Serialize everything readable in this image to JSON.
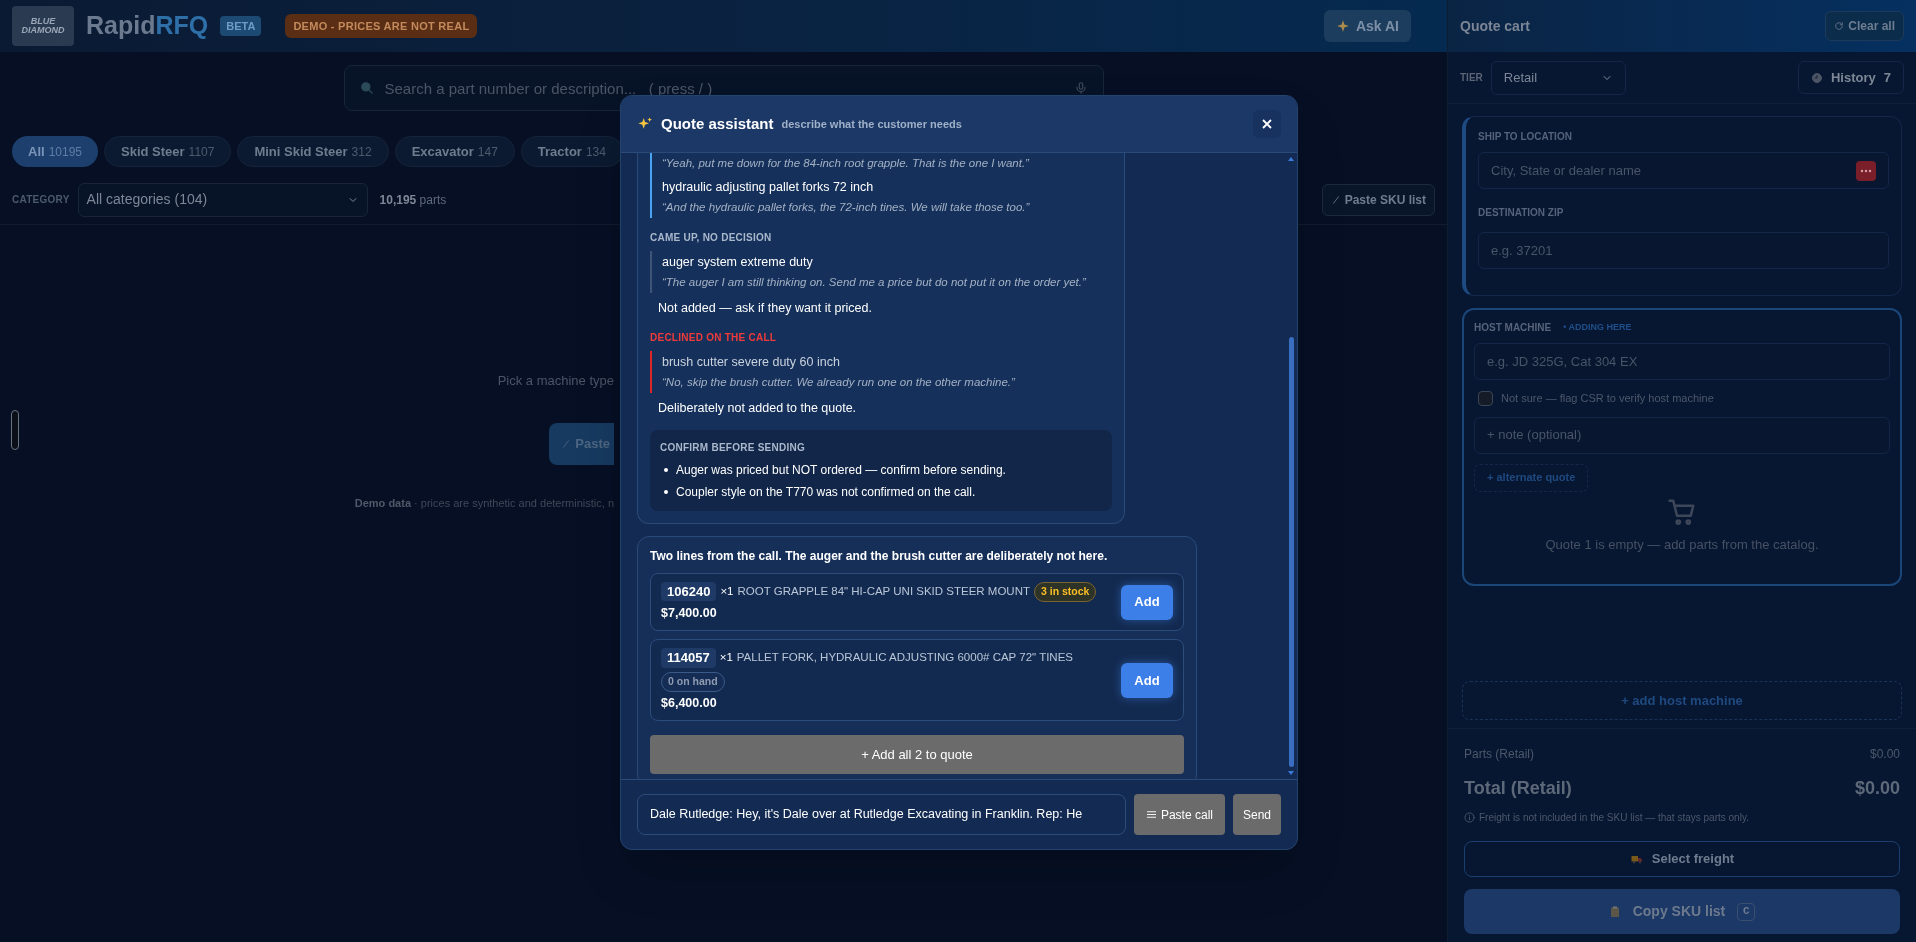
{
  "header": {
    "logo_text": "BLUE DIAMOND",
    "brand_prefix": "Rapid",
    "brand_suffix": "RFQ",
    "beta": "BETA",
    "demo_badge": "DEMO - PRICES ARE NOT REAL",
    "ask_ai": "Ask AI"
  },
  "search": {
    "placeholder": "Search a part number or description...   ( press / )"
  },
  "chips": [
    {
      "label": "All",
      "count": "10195",
      "selected": true
    },
    {
      "label": "Skid Steer",
      "count": "1107",
      "selected": false
    },
    {
      "label": "Mini Skid Steer",
      "count": "312",
      "selected": false
    },
    {
      "label": "Excavator",
      "count": "147",
      "selected": false
    },
    {
      "label": "Tractor",
      "count": "134",
      "selected": false
    }
  ],
  "category": {
    "label": "CATEGORY",
    "value": "All categories (104)",
    "count": "10,195",
    "unit": "parts",
    "paste_sku": "Paste SKU list"
  },
  "empty_state": {
    "prompt": "Pick a machine type",
    "button": "Paste",
    "demo_label": "Demo data",
    "demo_note": "· prices are synthetic and deterministic, n"
  },
  "assistant": {
    "title": "Quote assistant",
    "subtitle": "describe what the customer needs",
    "sections": [
      {
        "kind": "added",
        "items": [
          {
            "quote": "“Yeah, put me down for the 84-inch root grapple. That is the one I want.”"
          },
          {
            "name": "hydraulic adjusting pallet forks 72 inch",
            "quote": "“And the hydraulic pallet forks, the 72-inch tines. We will take those too.”"
          }
        ]
      },
      {
        "kind": "undecided",
        "heading": "CAME UP, NO DECISION",
        "items": [
          {
            "name": "auger system extreme duty",
            "quote": "“The auger I am still thinking on. Send me a price but do not put it on the order yet.”"
          }
        ],
        "note": "Not added — ask if they want it priced."
      },
      {
        "kind": "declined",
        "heading": "DECLINED ON THE CALL",
        "items": [
          {
            "name": "brush cutter severe duty 60 inch",
            "quote": "“No, skip the brush cutter. We already run one on the other machine.”"
          }
        ],
        "note": "Deliberately not added to the quote."
      }
    ],
    "confirm": {
      "heading": "CONFIRM BEFORE SENDING",
      "bullets": [
        "Auger was priced but NOT ordered — confirm before sending.",
        "Coupler style on the T770 was not confirmed on the call."
      ]
    },
    "suggestions": {
      "intro": "Two lines from the call. The auger and the brush cutter are deliberately not here.",
      "lines": [
        {
          "sku": "106240",
          "qty": "×1",
          "description": "ROOT GRAPPLE 84\" HI-CAP UNI SKID STEER MOUNT",
          "stock": "3 in stock",
          "kind": "in_stock",
          "price": "$7,400.00",
          "add": "Add"
        },
        {
          "sku": "114057",
          "qty": "×1",
          "description": "PALLET FORK, HYDRAULIC ADJUSTING 6000# CAP 72\" TINES",
          "stock": "0 on hand",
          "kind": "none",
          "price": "$6,400.00",
          "add": "Add"
        }
      ],
      "add_all": "+ Add all 2 to quote"
    },
    "input": {
      "value": "Dale Rutledge: Hey, it's Dale over at Rutledge Excavating in Franklin. Rep: He"
    },
    "paste_call": "Paste call",
    "send": "Send"
  },
  "cart": {
    "title": "Quote cart",
    "clear": "Clear all",
    "tier_label": "TIER",
    "tier": "Retail",
    "history": "History",
    "history_count": "7",
    "ship_label": "SHIP TO LOCATION",
    "ship_placeholder": "City, State or dealer name",
    "zip_label": "DESTINATION ZIP",
    "zip_placeholder": "e.g. 37201",
    "host_label": "HOST MACHINE",
    "host_tag": "• ADDING HERE",
    "host_placeholder": "e.g. JD 325G, Cat 304 EX",
    "not_sure": {
      "label": "Not sure — flag CSR to verify host machine",
      "checked": false
    },
    "note_placeholder": "+ note (optional)",
    "alternate": "+ alternate quote",
    "empty": "Quote 1 is empty — add parts from the catalog.",
    "add_host": "+ add host machine",
    "parts_label": "Parts (Retail)",
    "parts_value": "$0.00",
    "total_label": "Total (Retail)",
    "total_value": "$0.00",
    "info": "Freight is not included in the SKU list — that stays parts only.",
    "freight": "Select freight",
    "copy": "Copy SKU list",
    "copy_key": "C"
  }
}
